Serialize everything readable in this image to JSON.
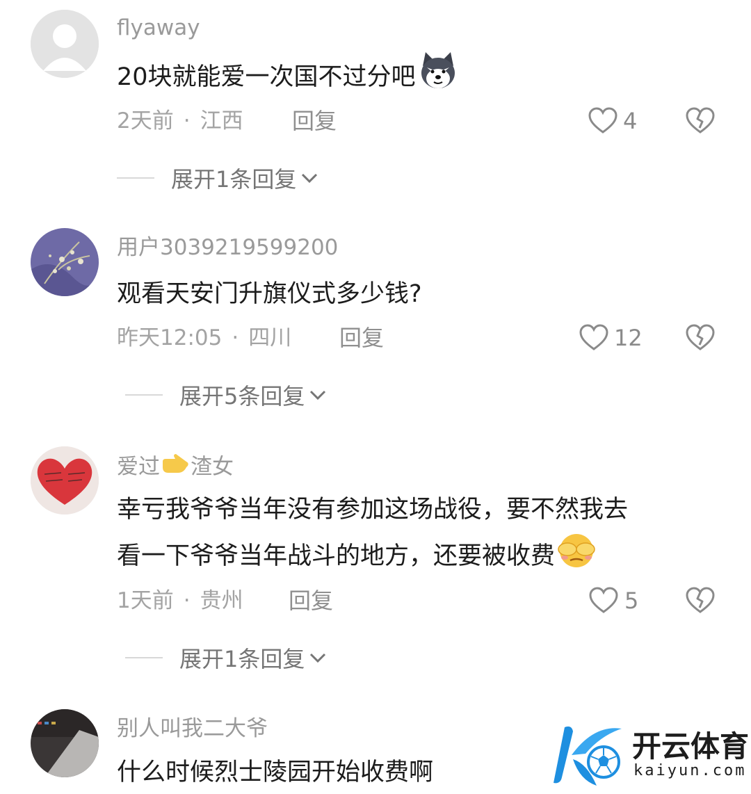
{
  "comments": [
    {
      "username": "flyaway",
      "text": "20块就能爱一次国不过分吧",
      "emoji": "husky-emoji-icon",
      "time": "2天前",
      "location": "江西",
      "reply_label": "回复",
      "likes": "4",
      "expand_label": "展开1条回复"
    },
    {
      "username": "用户3039219599200",
      "text": "观看天安门升旗仪式多少钱?",
      "time": "昨天12:05",
      "location": "四川",
      "reply_label": "回复",
      "likes": "12",
      "expand_label": "展开5条回复"
    },
    {
      "username_a": "爱过",
      "username_emoji": "pointing-hand-icon",
      "username_b": "渣女",
      "text_line1": "幸亏我爷爷当年没有参加这场战役，要不然我去",
      "text_line2": "看一下爷爷当年战斗的地方，还要被收费",
      "emoji": "face-covering-eyes-icon",
      "time": "1天前",
      "location": "贵州",
      "reply_label": "回复",
      "likes": "5",
      "expand_label": "展开1条回复"
    },
    {
      "username": "别人叫我二大爷",
      "text": "什么时候烈士陵园开始收费啊"
    }
  ],
  "watermark": {
    "title": "开云体育",
    "subtitle": "kaiyun.com",
    "logo_icon": "kaiyun-soccer-logo-icon"
  },
  "colors": {
    "username": "#9a9a9a",
    "text": "#1c1c1c",
    "meta": "#a3a3a3",
    "accent_blue": "#1e8fe0"
  }
}
